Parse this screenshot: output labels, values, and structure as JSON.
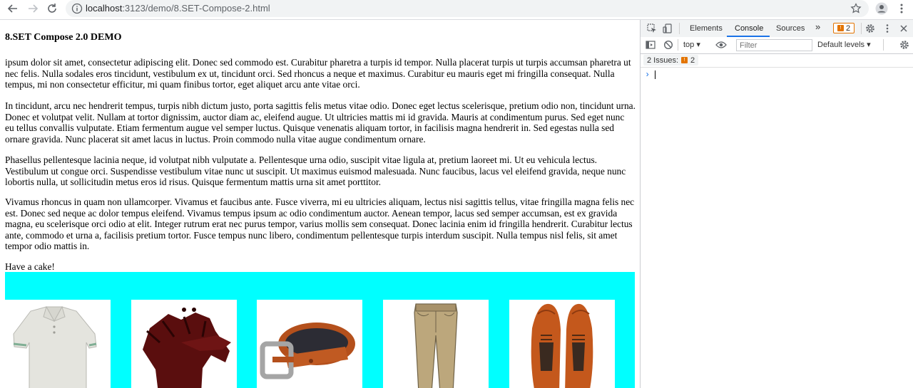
{
  "browser": {
    "url_host": "localhost",
    "url_rest": ":3123/demo/8.SET-Compose-2.html"
  },
  "page": {
    "title": "8.SET Compose 2.0 DEMO",
    "paragraphs": [
      "ipsum dolor sit amet, consectetur adipiscing elit. Donec sed commodo est. Curabitur pharetra a turpis id tempor. Nulla placerat turpis ut turpis accumsan pharetra ut nec felis. Nulla sodales eros tincidunt, vestibulum ex ut, tincidunt orci. Sed rhoncus a neque et maximus. Curabitur eu mauris eget mi fringilla consequat. Nulla tempus, mi non consectetur efficitur, mi quam finibus tortor, eget aliquet arcu ante vitae orci.",
      "In tincidunt, arcu nec hendrerit tempus, turpis nibh dictum justo, porta sagittis felis metus vitae odio. Donec eget lectus scelerisque, pretium odio non, tincidunt urna. Donec et volutpat velit. Nullam at tortor dignissim, auctor diam ac, eleifend augue. Ut ultricies mattis mi id gravida. Mauris at condimentum purus. Sed eget nunc eu tellus convallis vulputate. Etiam fermentum augue vel semper luctus. Quisque venenatis aliquam tortor, in facilisis magna hendrerit in. Sed egestas nulla sed ornare gravida. Nunc placerat sit amet lacus in luctus. Proin commodo nulla vitae augue condimentum ornare.",
      "Phasellus pellentesque lacinia neque, id volutpat nibh vulputate a. Pellentesque urna odio, suscipit vitae ligula at, pretium laoreet mi. Ut eu vehicula lectus. Vestibulum ut congue orci. Suspendisse vestibulum vitae nunc ut suscipit. Ut maximus euismod malesuada. Nunc faucibus, lacus vel eleifend gravida, neque nunc lobortis nulla, ut sollicitudin metus eros id risus. Quisque fermentum mattis urna sit amet porttitor.",
      "Vivamus rhoncus in quam non ullamcorper. Vivamus et faucibus ante. Fusce viverra, mi eu ultricies aliquam, lectus nisi sagittis tellus, vitae fringilla magna felis nec est. Donec sed neque ac dolor tempus eleifend. Vivamus tempus ipsum ac odio condimentum auctor. Aenean tempor, lacus sed semper accumsan, est ex gravida magna, eu scelerisque orci odio at elit. Integer rutrum erat nec purus tempor, varius mollis sem consequat. Donec lacinia enim id fringilla hendrerit. Curabitur lectus ante, commodo et urna a, facilisis pretium tortor. Fusce tempus nunc libero, condimentum pellentesque turpis interdum suscipit. Nulla tempus nisl felis, sit amet tempor odio mattis in.",
      "Have a cake!"
    ],
    "banner_color": "#00ffff",
    "products": [
      {
        "icon": "polo-shirt-icon"
      },
      {
        "icon": "leather-gloves-icon"
      },
      {
        "icon": "leather-belt-icon"
      },
      {
        "icon": "khaki-pants-icon"
      },
      {
        "icon": "oxford-shoes-icon"
      }
    ]
  },
  "devtools": {
    "tabs": [
      "Elements",
      "Console",
      "Sources"
    ],
    "active_tab": "Console",
    "more_tabs": "»",
    "issues_count": "2",
    "context": "top ▾",
    "filter_placeholder": "Filter",
    "levels": "Default levels ▾",
    "issues_label": "2 Issues:",
    "issues_badge_count": "2",
    "prompt": "›",
    "accent": "#1a73e8",
    "warning_color": "#e37400"
  }
}
